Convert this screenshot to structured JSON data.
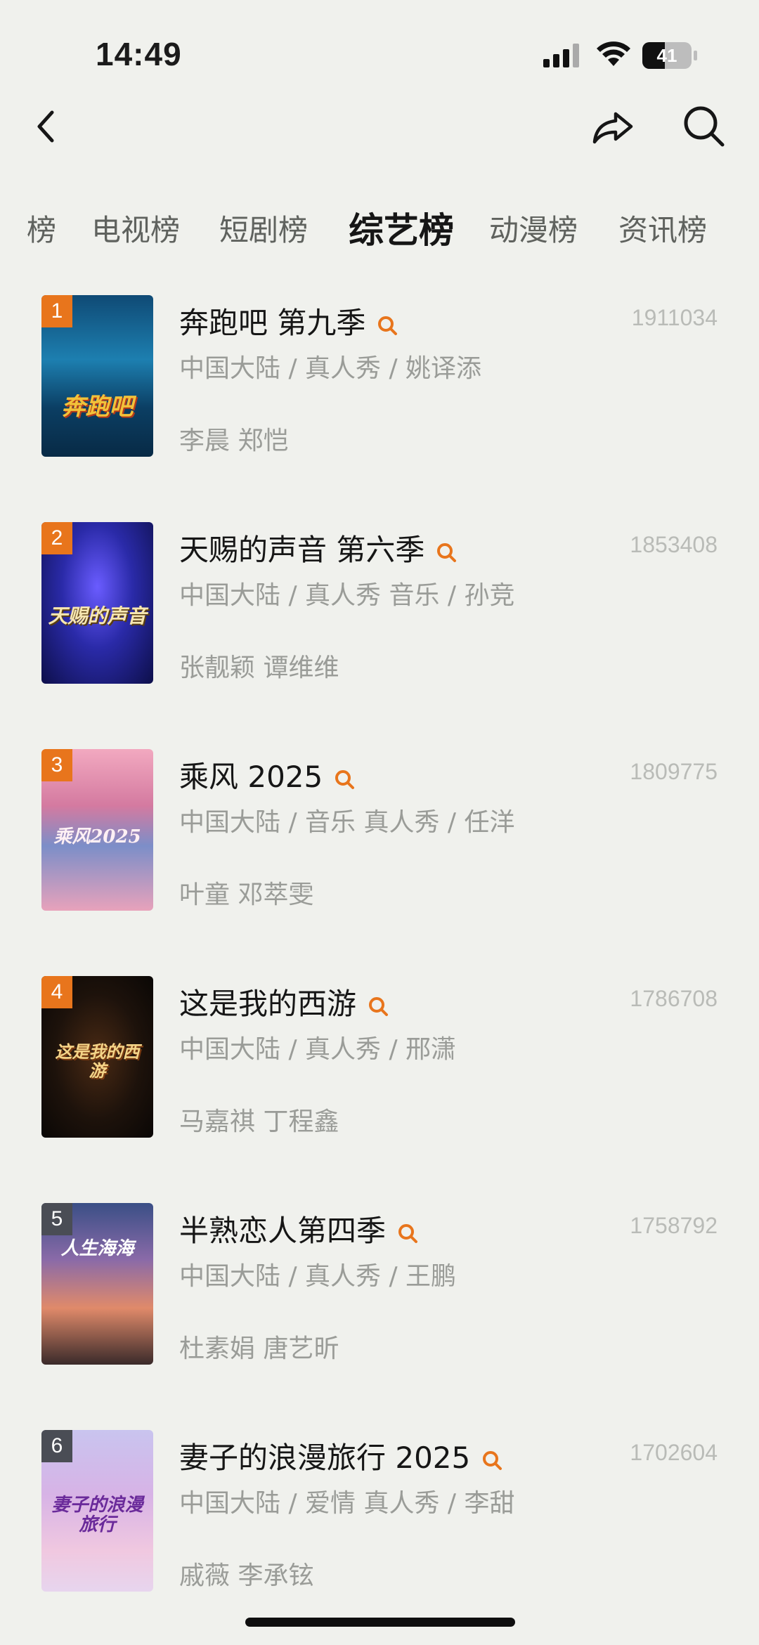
{
  "status": {
    "time": "14:49",
    "battery": "41"
  },
  "tabs": [
    "榜",
    "电视榜",
    "短剧榜",
    "综艺榜",
    "动漫榜",
    "资讯榜"
  ],
  "active_tab": "综艺榜",
  "items": [
    {
      "rank": "1",
      "title": "奔跑吧 第九季",
      "meta": "中国大陆 / 真人秀 / 姚译添",
      "cast": "李晨 郑恺",
      "score": "1911034",
      "poster_text": "奔跑吧"
    },
    {
      "rank": "2",
      "title": "天赐的声音 第六季",
      "meta": "中国大陆 / 真人秀 音乐 / 孙竞",
      "cast": "张靓颖 谭维维",
      "score": "1853408",
      "poster_text": "天赐的声音"
    },
    {
      "rank": "3",
      "title": "乘风 2025",
      "meta": "中国大陆 / 音乐 真人秀 / 任洋",
      "cast": "叶童 邓萃雯",
      "score": "1809775",
      "poster_text": "乘风2025"
    },
    {
      "rank": "4",
      "title": "这是我的西游",
      "meta": "中国大陆 / 真人秀 / 邢潇",
      "cast": "马嘉祺 丁程鑫",
      "score": "1786708",
      "poster_text": "这是我的西游"
    },
    {
      "rank": "5",
      "title": "半熟恋人第四季",
      "meta": "中国大陆 / 真人秀 / 王鹏",
      "cast": "杜素娟 唐艺昕",
      "score": "1758792",
      "poster_text": "人生海海"
    },
    {
      "rank": "6",
      "title": "妻子的浪漫旅行 2025",
      "meta": "中国大陆 / 爱情 真人秀 / 李甜",
      "cast": "戚薇 李承铉",
      "score": "1702604",
      "poster_text": "妻子的浪漫旅行"
    }
  ],
  "colors": {
    "accent": "#e8751c",
    "background": "#f0f1ed"
  }
}
